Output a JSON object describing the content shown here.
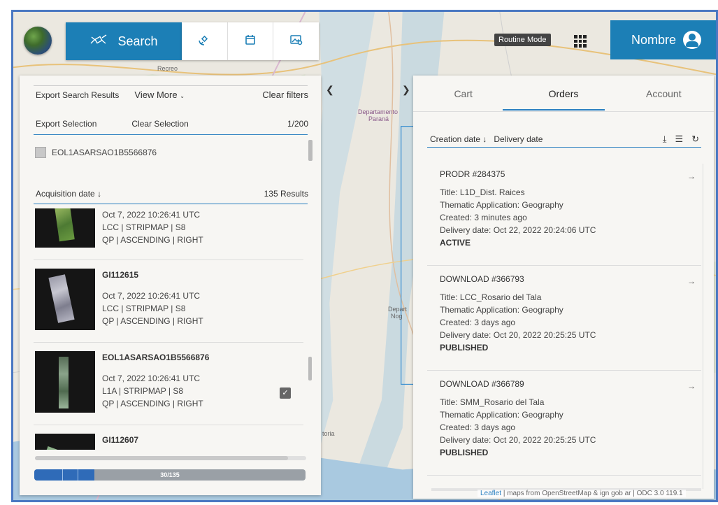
{
  "toolbar": {
    "search_label": "Search",
    "tools": [
      "satellite-icon",
      "calendar-icon",
      "image-settings-icon"
    ],
    "routine_mode": "Routine Mode",
    "user_name": "Nombre"
  },
  "map": {
    "labels": [
      "Recreo",
      "Departamento",
      "Paraná",
      "Depart",
      "Nog",
      "toria"
    ],
    "attribution_link": "Leaflet",
    "attribution_text": "| maps from OpenStreetMap & ign gob ar | ODC 3.0 119.1"
  },
  "left_panel": {
    "export_search_results": "Export Search Results",
    "view_more": "View More",
    "clear_filters": "Clear filters",
    "export_selection": "Export Selection",
    "clear_selection": "Clear Selection",
    "selection_count": "1/200",
    "selected_item": "EOL1ASARSAO1B5566876",
    "sort_label": "Acquisition date",
    "results_count": "135 Results",
    "results": [
      {
        "title": "",
        "date": "Oct 7, 2022 10:26:41 UTC",
        "mode": "LCC | STRIPMAP | S8",
        "orbit": "QP | ASCENDING | RIGHT",
        "checked": false
      },
      {
        "title": "GI112615",
        "date": "Oct 7, 2022 10:26:41 UTC",
        "mode": "LCC | STRIPMAP | S8",
        "orbit": "QP | ASCENDING | RIGHT",
        "checked": false
      },
      {
        "title": "EOL1ASARSAO1B5566876",
        "date": "Oct 7, 2022 10:26:41 UTC",
        "mode": "L1A | STRIPMAP | S8",
        "orbit": "QP | ASCENDING | RIGHT",
        "checked": true
      },
      {
        "title": "GI112607",
        "date": "",
        "mode": "",
        "orbit": "",
        "checked": false
      }
    ],
    "progress_label": "30/135",
    "progress_fraction": 0.222
  },
  "right_panel": {
    "tabs": [
      "Cart",
      "Orders",
      "Account"
    ],
    "active_tab": "Orders",
    "sort_creation": "Creation date",
    "sort_delivery": "Delivery date",
    "orders": [
      {
        "id": "PRODR #284375",
        "title": "Title: L1D_Dist. Raices",
        "application": "Thematic Application: Geography",
        "created": "Created: 3 minutes ago",
        "delivery": "Delivery date: Oct 22, 2022 20:24:06 UTC",
        "status": "ACTIVE"
      },
      {
        "id": "DOWNLOAD #366793",
        "title": "Title: LCC_Rosario del Tala",
        "application": "Thematic Application: Geography",
        "created": "Created: 3 days ago",
        "delivery": "Delivery date: Oct 20, 2022 20:25:25 UTC",
        "status": "PUBLISHED"
      },
      {
        "id": "DOWNLOAD #366789",
        "title": "Title: SMM_Rosario del Tala",
        "application": "Thematic Application: Geography",
        "created": "Created: 3 days ago",
        "delivery": "Delivery date: Oct 20, 2022 20:25:25 UTC",
        "status": "PUBLISHED"
      }
    ]
  },
  "colors": {
    "primary": "#1c7fb6",
    "accent_line": "#2a7fc0",
    "frame": "#4a78c2",
    "progress_fill": "#2f6bb8"
  }
}
